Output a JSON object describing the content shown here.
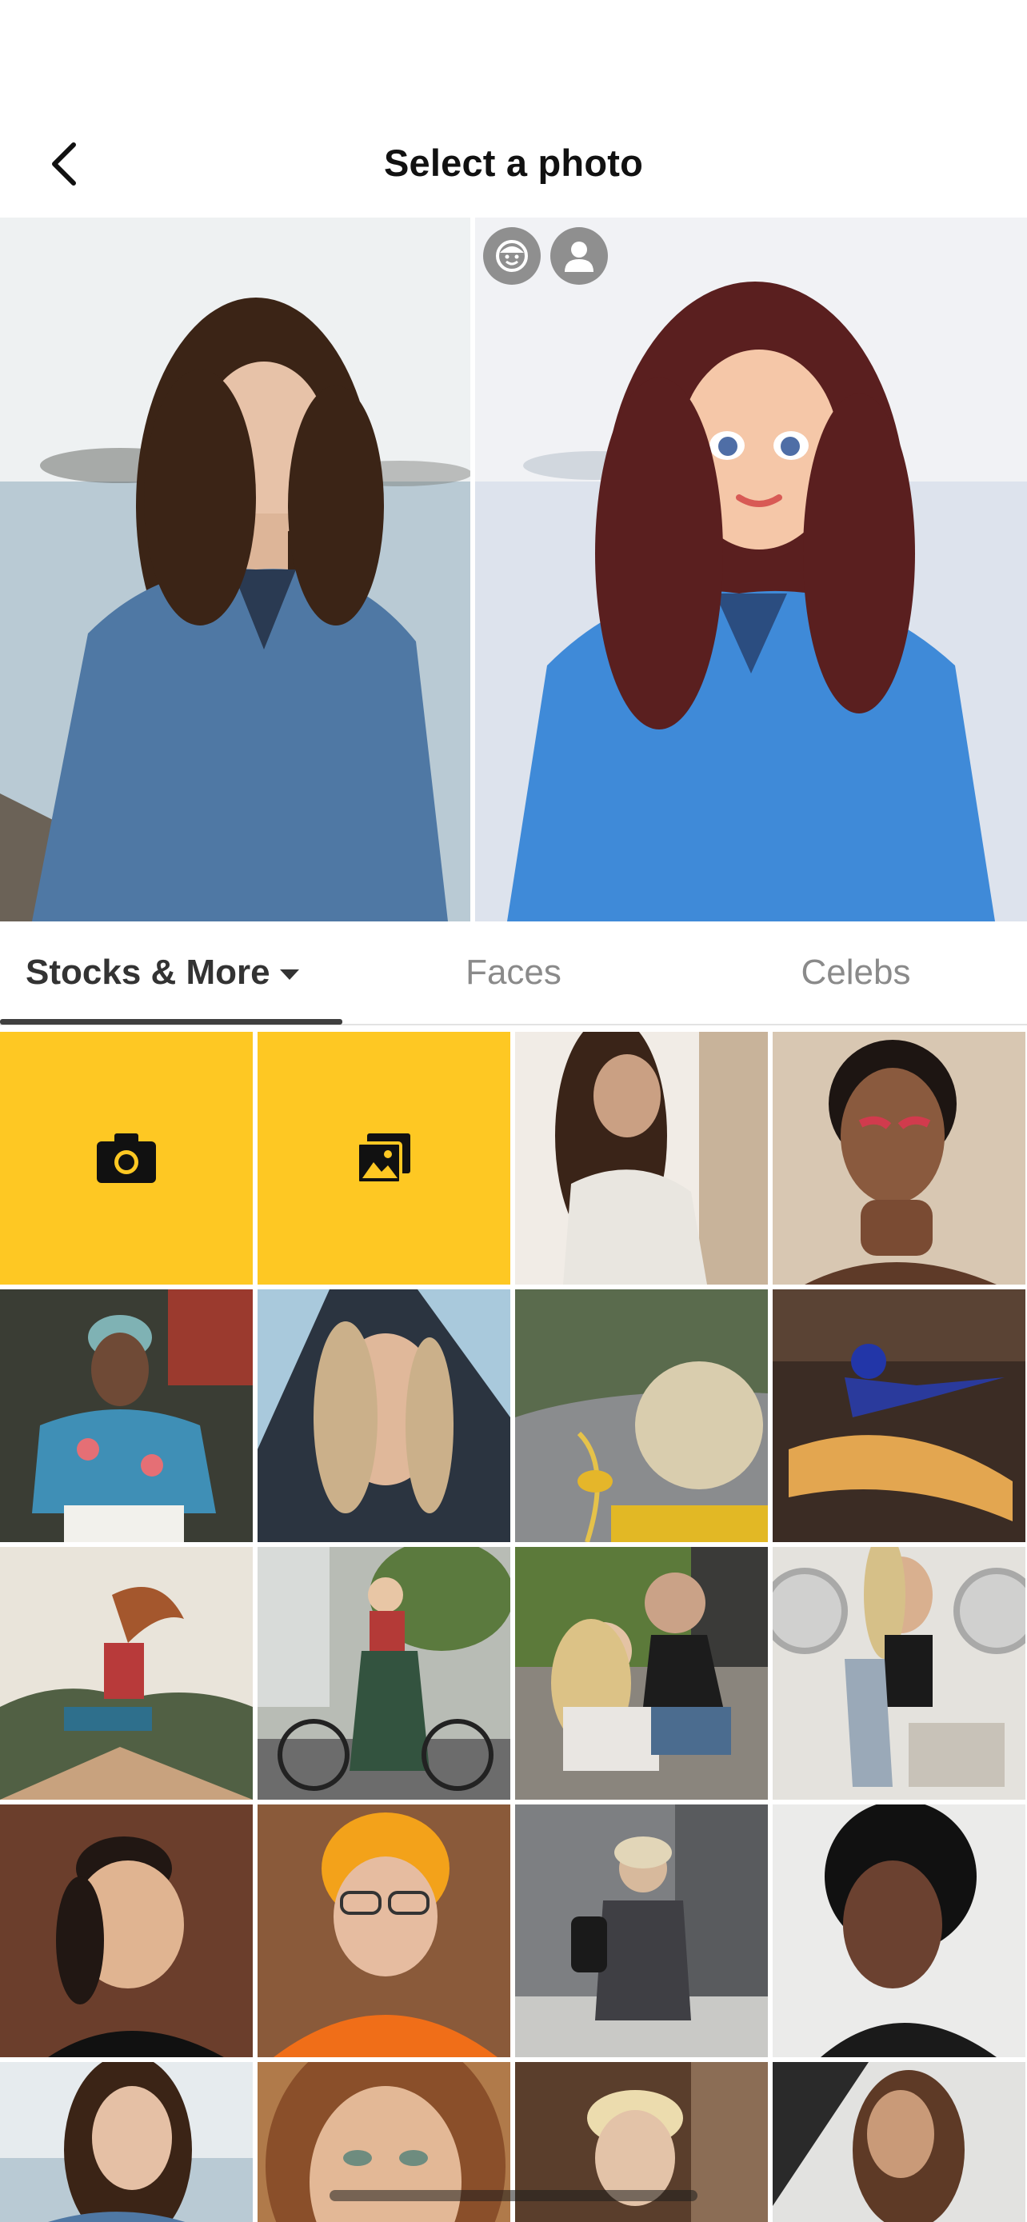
{
  "header": {
    "title": "Select a photo"
  },
  "preview": {
    "icons": [
      "cartoon-face-icon",
      "person-icon"
    ]
  },
  "tabs": [
    {
      "label": "Stocks & More",
      "active": true
    },
    {
      "label": "Faces",
      "active": false
    },
    {
      "label": "Celebs",
      "active": false
    }
  ],
  "grid": {
    "actions": [
      {
        "icon": "camera-icon"
      },
      {
        "icon": "gallery-icon"
      }
    ],
    "accent_color": "#fec823"
  }
}
